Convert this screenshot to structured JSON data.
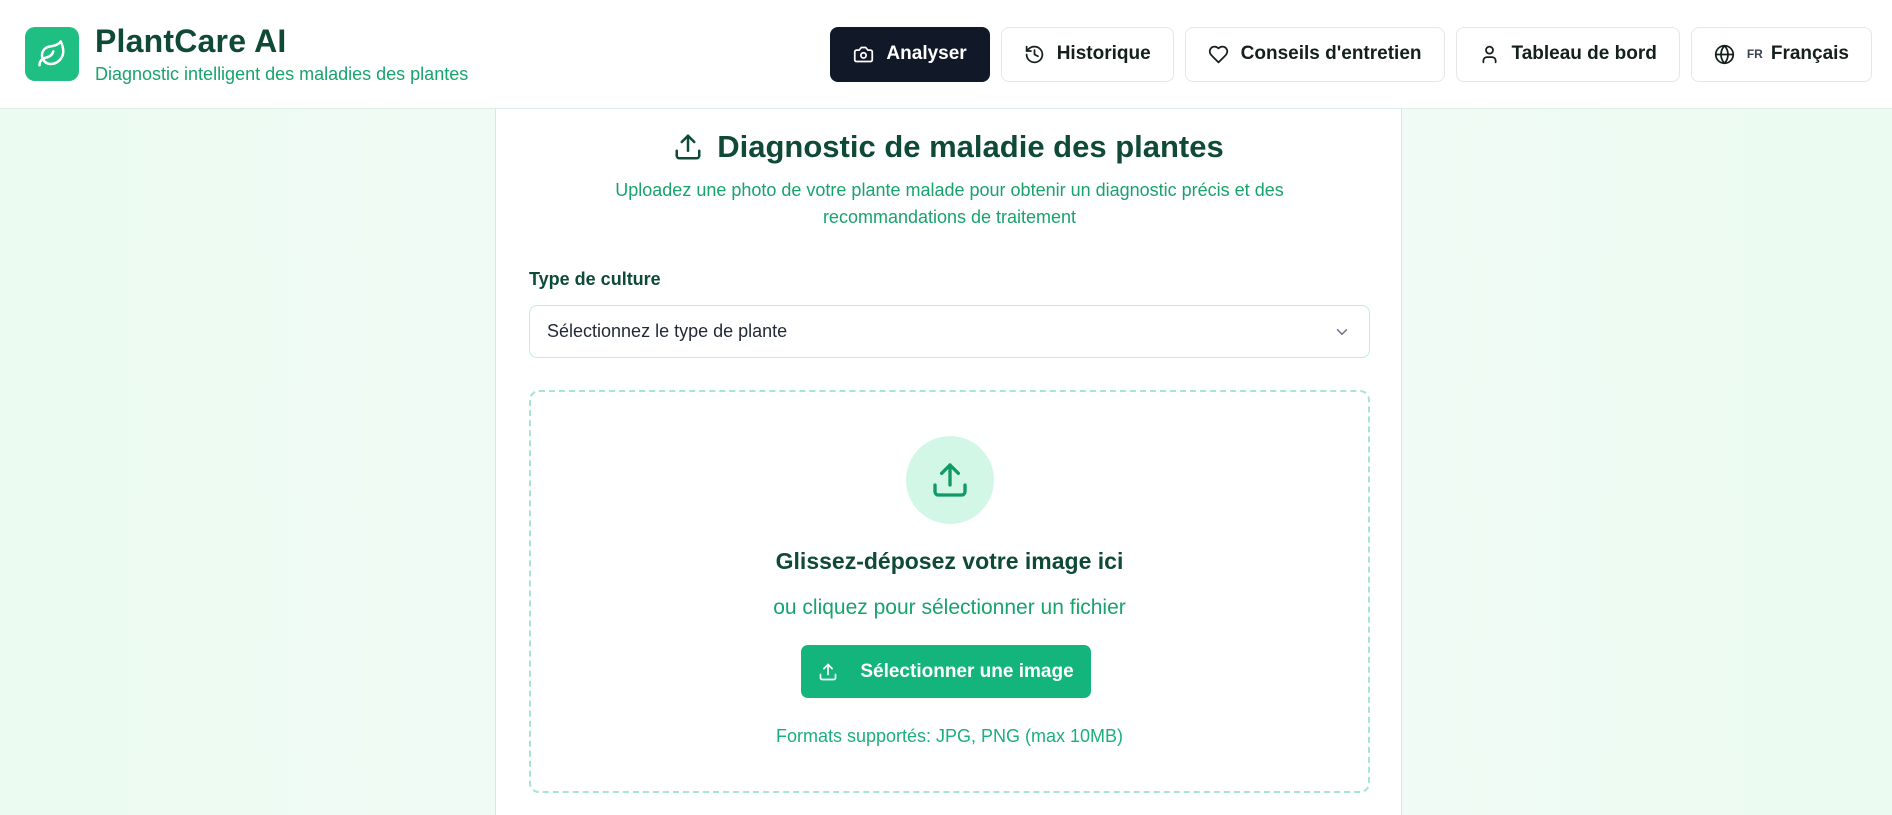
{
  "brand": {
    "title": "PlantCare AI",
    "subtitle": "Diagnostic intelligent des maladies des plantes",
    "logo_icon": "leaf-icon",
    "color": "#1fbf84"
  },
  "nav": {
    "analyze": {
      "label": "Analyser",
      "icon": "camera-icon",
      "active": true
    },
    "history": {
      "label": "Historique",
      "icon": "history-icon"
    },
    "care": {
      "label": "Conseils d'entretien",
      "icon": "heart-icon"
    },
    "dashboard": {
      "label": "Tableau de bord",
      "icon": "user-icon"
    },
    "language": {
      "code": "FR",
      "label": "Français",
      "icon": "globe-icon"
    }
  },
  "diagnosis": {
    "title": "Diagnostic de maladie des plantes",
    "description": "Uploadez une photo de votre plante malade pour obtenir un diagnostic précis et des recommandations de traitement",
    "crop_label": "Type de culture",
    "crop_placeholder": "Sélectionnez le type de plante",
    "dropzone": {
      "title": "Glissez-déposez votre image ici",
      "subtitle": "ou cliquez pour sélectionner un fichier",
      "button_label": "Sélectionner une image",
      "formats": "Formats supportés: JPG, PNG (max 10MB)"
    }
  },
  "colors": {
    "accent": "#14b57c",
    "dark_green": "#0f4a36",
    "text_green": "#18a36e",
    "active_nav": "#111827"
  }
}
